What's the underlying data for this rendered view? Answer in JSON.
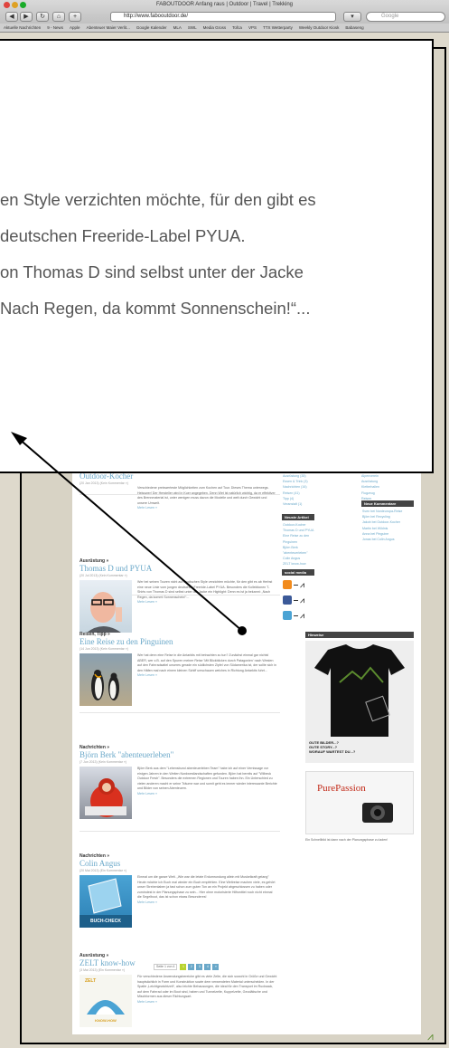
{
  "browser": {
    "title": "FABOUTDOOR Anfang raus | Outdoor | Travel | Trekking",
    "url": "http://www.fabooutdoor.de/",
    "search_placeholder": "Google",
    "bookmarks": [
      "Aktuelle Nachrichten",
      "9 - News",
      "Apple",
      "Abenteuer Maier Verlit...",
      "Google Kalender",
      "MLA",
      "SWL",
      "Media Gross",
      "Tofca",
      "VPS",
      "TTX Wetterparty",
      "Weekly Outdoor Kiosk",
      "Babaseng"
    ]
  },
  "zoom": {
    "lines": [
      "en Style verzichten möchte, für den gibt es",
      "deutschen Freeride-Label PYUA.",
      "on Thomas D sind selbst unter der Jacke",
      "Nach Regen, da kommt Sonnenschein!“..."
    ]
  },
  "posts": [
    {
      "category": "",
      "title": "Outdoor-Kocher",
      "meta": "(20 Jan 2013) (Kein Kommentar »)",
      "text": "Verschiedene preiswerteste Möglichkeiten zum Kochen auf Tour. Dieses Thema unterwegs. Heisswer! Der Hersteller wird in Kuer angegeben. Denn Wet ist natürlich wichtig, da er effektiver des Brennmaterial ist, unter wenigen muss davon die Modelle und welt durch Gewicht und unsere Umwelt.",
      "more": "Mehr Lesen »"
    },
    {
      "category": "Ausrüstung »",
      "title": "Thomas D und PYUA",
      "meta": "(20 Jul 2013) (Kein Kommentar »)",
      "text": "Wer bei seinen Touren nicht auf modischen Style verzichten möchte, für den gibt es ab Herbst eine neue Linie vom jungen deutschen Freeride-Label PYUA. Besonders die Kollektionen T-Shirts von Thomas D sind selbst unter der Jacke ein Highlight: Denn es ist ja bekannt: „Nach Regen, da kommt Sonnenschein!“...",
      "more": "Mehr Lesen »"
    },
    {
      "category": "Reisen, Tipp »",
      "title": "Eine Reise zu den Pinguinen",
      "meta": "(14 Jun 2013) (Kein Kommentar »)",
      "text": "Wer hat denn eine Reise in die Antarktis mit betrachten zu tun? Zunächst einmal gar nichts! ABER, wer z.B. auf den Spuren meiner Reise 'Mit Blickblicken durch Patagonien' nach Westen auf den Fahrradsattel unseres gerade ein südlichsten Zipfel von Südamerika ist, der sollte sich in den Häfen mal nach einem kleinen Schiff umschauen welches in Richtung Antarktis fuhrt...",
      "more": "Mehr Lesen »"
    },
    {
      "category": "Nachrichten »",
      "title": "Björn Berk \"abenteuerleben\"",
      "meta": "(7 Jun 2013) (Kein Kommentar »)",
      "text": "Björn Berk aus dem \"Lebensbund abenteuerleben Team\" habe ich auf einer Vernissage vor einigen Jahren in den Weiten Nordwestlandschaften gefunden. Björn hat bereits auf \"Wilbeck Outdoor Fresh\". Besonders die extremen Regionen und Touren haben ihn. Ein Unterschied zu vielen anderen macht er seine Träume war und somit geht es immer wieder interessante Berichte und Bilder von seinen Abenteuern.",
      "more": "Mehr Lesen »"
    },
    {
      "category": "Nachrichten »",
      "title": "Colin Angus",
      "meta": "(20 Mai 2013) (Ein Kommentar »)",
      "text": "Einmal um die ganze Welt. „Wie war die letzte Erdumrundung allein mit Muskelkraft gelang\" Heute möchte ich Euch mal wieder ein Buch empfehlen. Eine Weltreise machen viele, es gehört unser Strebenlaben ja fast schon zum guten Ton an ein Projekt abgeschlossen zu haben oder zumindest in der Planungsphase zu sein... Hier ohne motorisierte Hilfsmittel noch nicht einmal die Segelboot, das ist schon etwas Besonderes!",
      "more": "Mehr Lesen »",
      "thumb_label": "BUCH-CHECK"
    },
    {
      "category": "Ausrüstung »",
      "title": "ZELT know-how",
      "meta": "(3 Mai 2013) (Ein Kommentar »)",
      "text": "Für verschiedene Anwendungsbereiche gibt es viele Zelte, die sich sowohl in Größe und Gewicht hauptsächlich in Form und Konstruktion sowie dem verwendeten Material unterscheiden. In der Spalte „Leichtgewichtzelt“, also leichte Behausungen, die ideal für den Transport im Rucksack, auf dem Fahrrad oder im Boot sind, haben und Tunnelzelte, Kuppelzelte, Geodätische und Mischformen aus dieser Richtungsart.",
      "more": "Mehr Lesen »",
      "thumb_label": "ZELT",
      "thumb_sub": "KNOW-HOW"
    }
  ],
  "sidebar": {
    "categories": [
      "Ausrüstung (35)",
      "Essen & Trink (3)",
      "Nachrichten (16)",
      "Reisen (41)",
      "Tipp (4)",
      "Veranstalt (1)"
    ],
    "tags": [
      "Alpenverein",
      "Ausrüstung",
      "Kletterhallen",
      "Flugzeug",
      "Reisen"
    ],
    "neuste_artikel_title": "Neuste Artikel",
    "neuste_artikel": [
      "Outdoor-Kocher",
      "Thomas D und PYUA",
      "Eine Reise zu den Pinguinen",
      "Björn Berk \"abenteuerleben\"",
      "Colin Angus",
      "ZELT know-how"
    ],
    "neue_kommentare_title": "Neue Kommentare",
    "neue_kommentare": [
      "Sven bei Nordeuropa-Reise",
      "Björn bei Recycling",
      "Jakob bei Outdoor-Kocher",
      "Martin bei Wildnis",
      "Anna bei Pinguine",
      "Jonas bei Colin Angus"
    ],
    "social_title": "social media",
    "hinweise_title": "Hinweise",
    "tshirt_text": [
      "GUTE BILDER...?",
      "GUTE STORY...?",
      "WORAUF WARTEST DU...?"
    ],
    "ad_brand": "PurePassion",
    "ad_caption": "Ein Schnellbild ist dann nach der Planungsphase zu laden!"
  },
  "pagination": {
    "label": "Seite 1 von 4",
    "pages": [
      "1",
      "2",
      "3",
      "4",
      "»"
    ],
    "active": "1"
  }
}
